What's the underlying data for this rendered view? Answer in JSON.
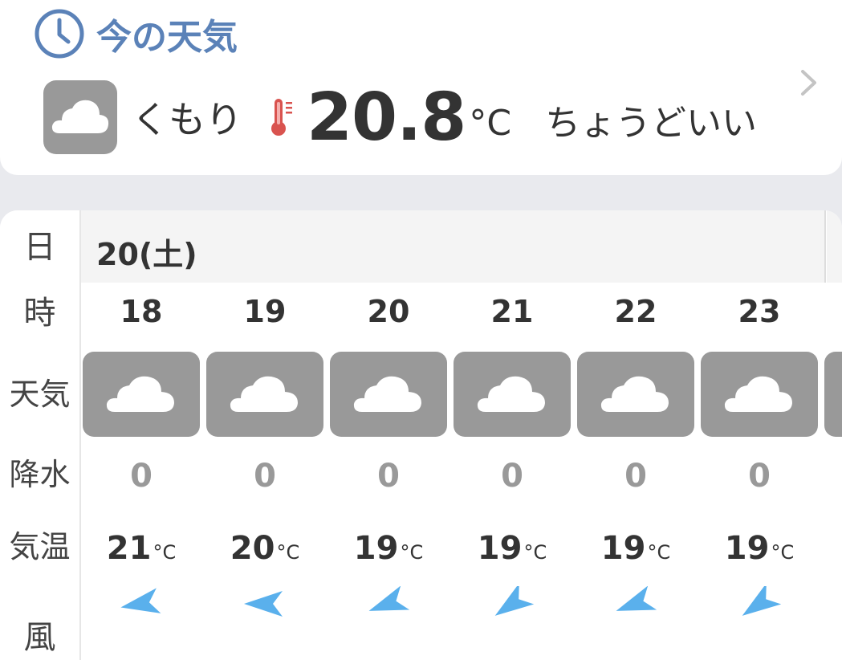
{
  "now": {
    "title": "今の天気",
    "condition": "くもり",
    "temperature": "20.8",
    "unit": "°C",
    "feel": "ちょうどいい"
  },
  "forecast": {
    "row_labels": [
      "日",
      "時",
      "天気",
      "降水",
      "気温",
      "風"
    ],
    "date": "20(土)",
    "temp_unit": "°C",
    "hours": [
      {
        "hour": "18",
        "weather": "cloud-icon",
        "precip": "0",
        "temp": "21",
        "wind_dir_deg": 80
      },
      {
        "hour": "19",
        "weather": "cloud-icon",
        "precip": "0",
        "temp": "20",
        "wind_dir_deg": 90
      },
      {
        "hour": "20",
        "weather": "cloud-icon",
        "precip": "0",
        "temp": "19",
        "wind_dir_deg": 70
      },
      {
        "hour": "21",
        "weather": "cloud-icon",
        "precip": "0",
        "temp": "19",
        "wind_dir_deg": 55
      },
      {
        "hour": "22",
        "weather": "cloud-icon",
        "precip": "0",
        "temp": "19",
        "wind_dir_deg": 70
      },
      {
        "hour": "23",
        "weather": "cloud-icon",
        "precip": "0",
        "temp": "19",
        "wind_dir_deg": 55
      }
    ]
  },
  "colors": {
    "accent": "#5b82b8",
    "icon_bg": "#999999",
    "wind": "#5ab0ec",
    "thermo": "#d9534f"
  }
}
